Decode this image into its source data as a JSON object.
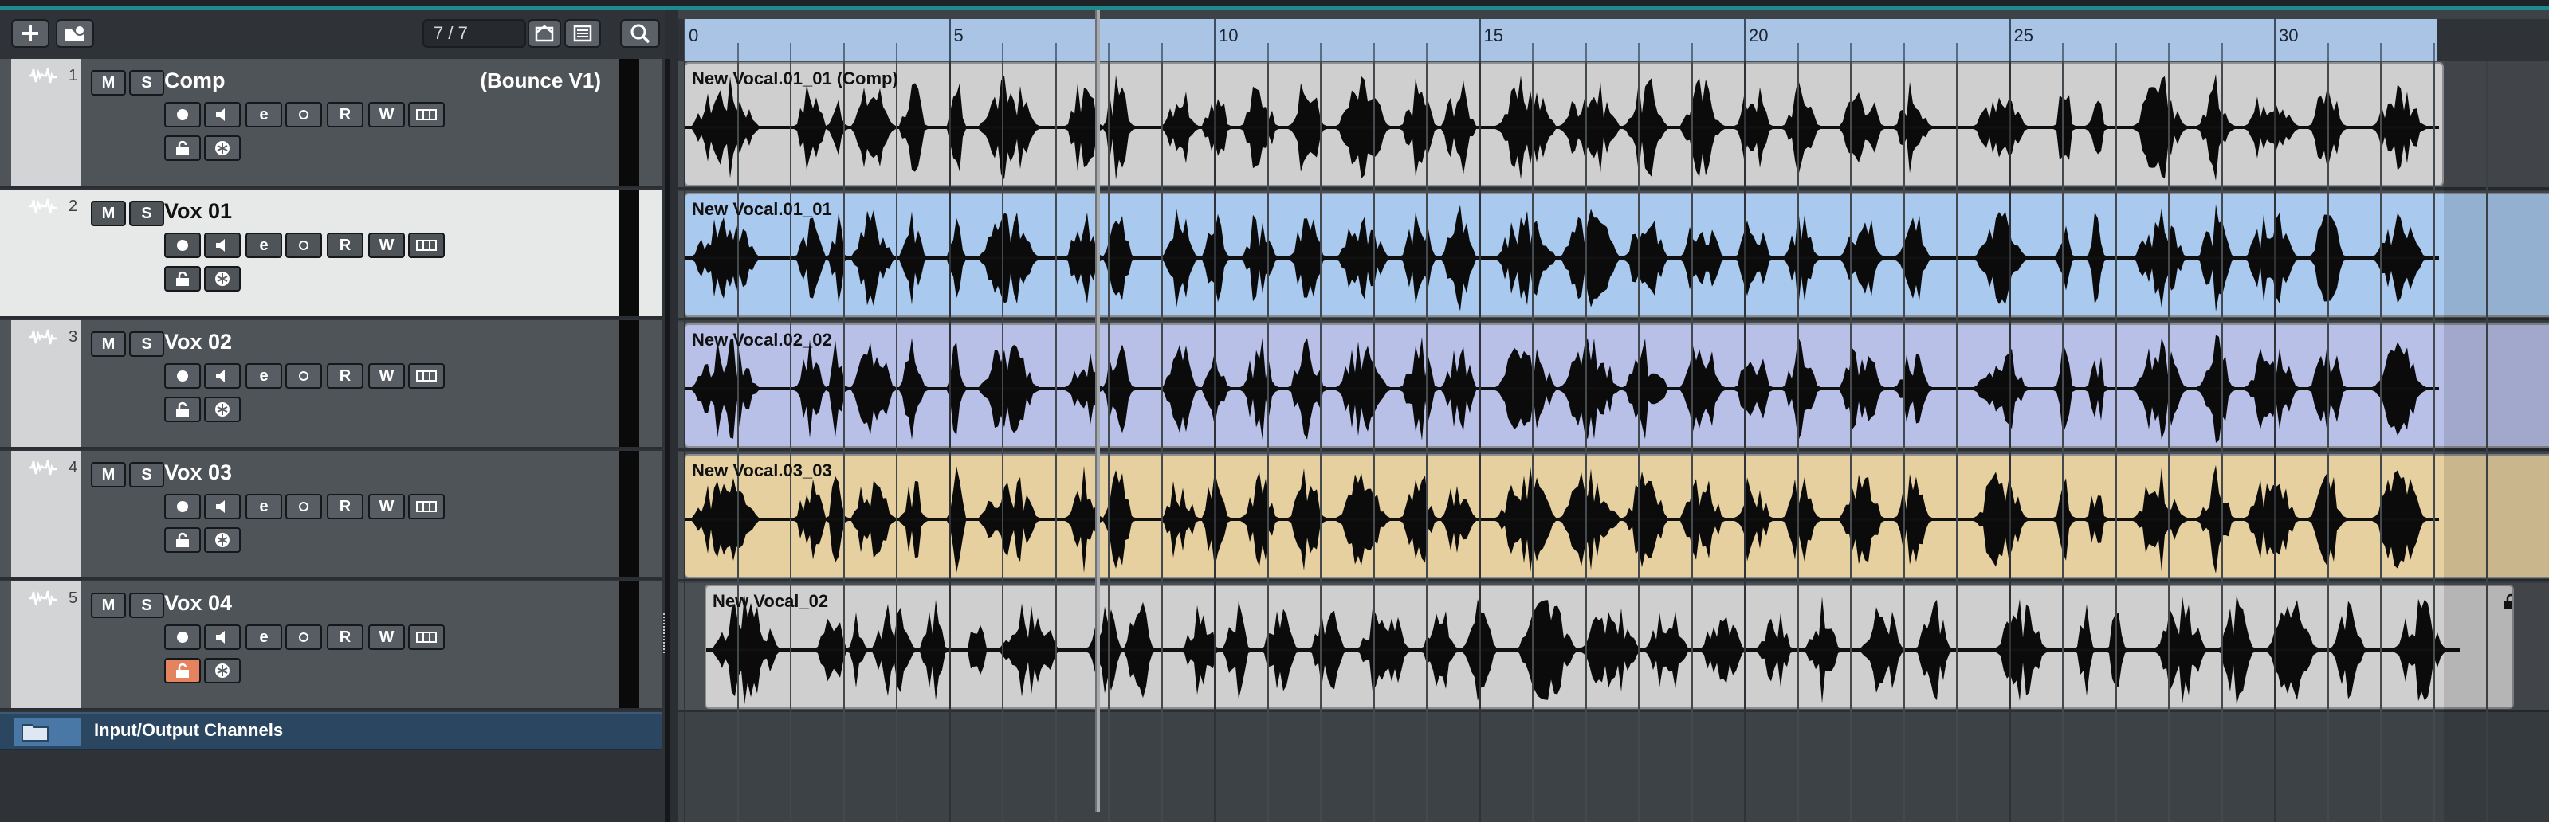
{
  "toolbar": {
    "add_icon": "plus-icon",
    "add_folder_icon": "folder-add-icon",
    "track_count": "7 / 7",
    "visibility_icon": "visibility-icon",
    "list_icon": "list-icon",
    "search_icon": "search-icon"
  },
  "tracks": [
    {
      "number": "1",
      "name": "Comp",
      "subtitle": "(Bounce V1)",
      "selected": false,
      "locked": false
    },
    {
      "number": "2",
      "name": "Vox 01",
      "subtitle": "",
      "selected": true,
      "locked": false
    },
    {
      "number": "3",
      "name": "Vox 02",
      "subtitle": "",
      "selected": false,
      "locked": false
    },
    {
      "number": "4",
      "name": "Vox 03",
      "subtitle": "",
      "selected": false,
      "locked": false
    },
    {
      "number": "5",
      "name": "Vox 04",
      "subtitle": "",
      "selected": false,
      "locked": true
    }
  ],
  "track_buttons": {
    "mute": "M",
    "solo": "S",
    "read": "R",
    "write": "W",
    "edit": "e"
  },
  "io_channels": {
    "label": "Input/Output Channels"
  },
  "ruler": {
    "labels": [
      "0",
      "5",
      "10",
      "15",
      "20",
      "25",
      "30"
    ]
  },
  "events": [
    {
      "track": 1,
      "name": "New Vocal.01_01 (Comp)",
      "color": "#cfcfcf",
      "locked": false
    },
    {
      "track": 2,
      "name": "New Vocal.01_01",
      "color": "#a9c9ee",
      "locked": false
    },
    {
      "track": 3,
      "name": "New Vocal.02_02",
      "color": "#b8c0e8",
      "locked": false
    },
    {
      "track": 4,
      "name": "New Vocal.03_03",
      "color": "#e6d0a0",
      "locked": false
    },
    {
      "track": 5,
      "name": "New Vocal_02",
      "color": "#cfcfcf",
      "locked": true
    }
  ],
  "colors": {
    "accent": "#1d8a8f",
    "selected_track": "#e7e8e8",
    "lock_active": "#e5835f"
  }
}
